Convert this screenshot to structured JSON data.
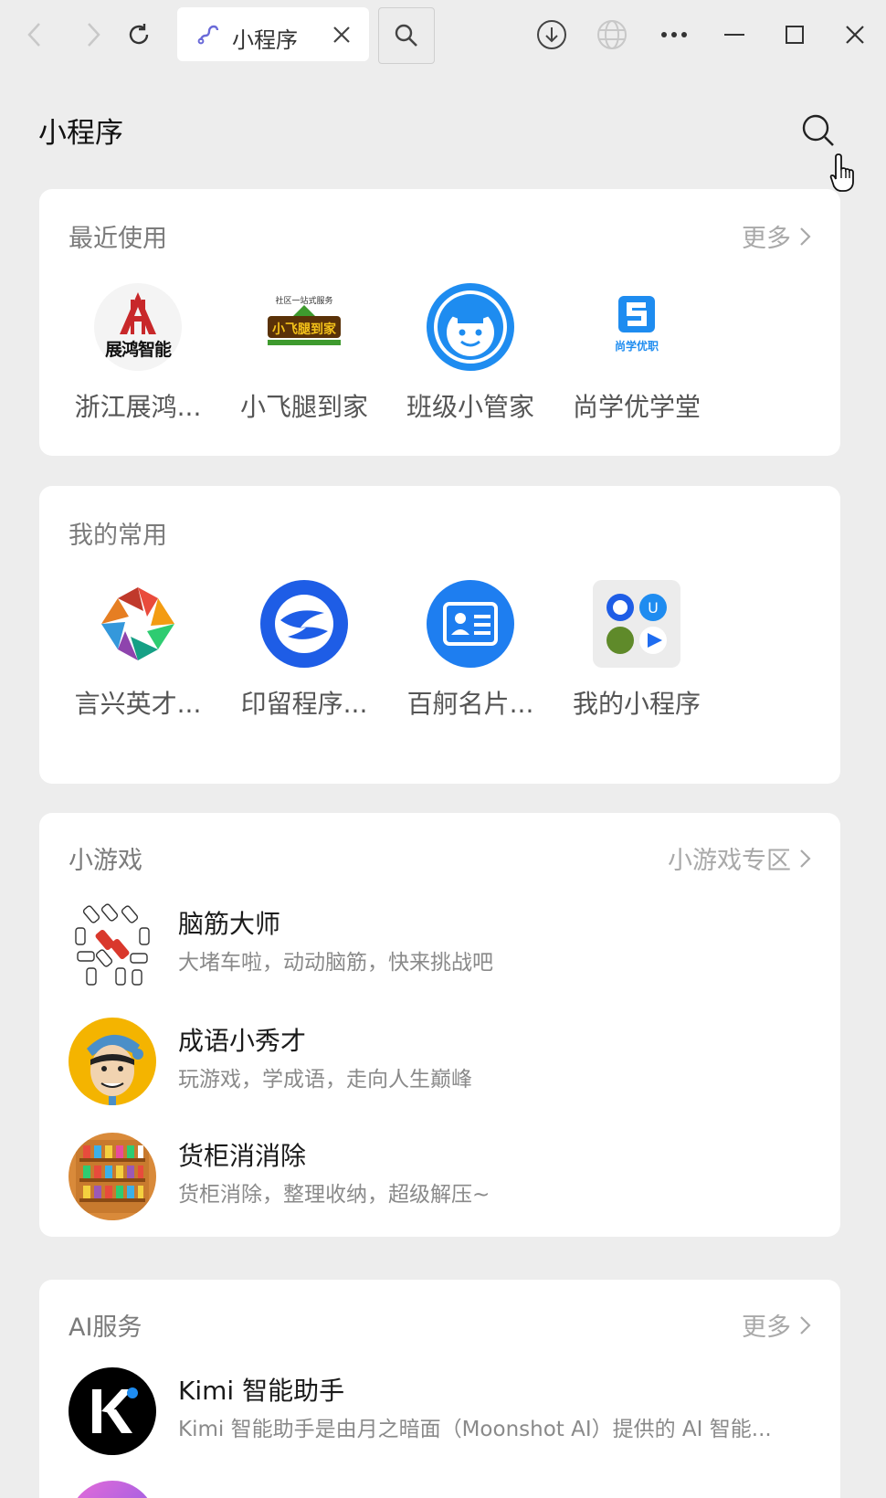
{
  "tab": {
    "title": "小程序"
  },
  "page": {
    "title": "小程序"
  },
  "recent": {
    "title": "最近使用",
    "more": "更多",
    "apps": [
      {
        "label": "浙江展鸿...",
        "icon": "zhanhong-logo"
      },
      {
        "label": "小飞腿到家",
        "icon": "xiaofeitui-logo"
      },
      {
        "label": "班级小管家",
        "icon": "banji-logo"
      },
      {
        "label": "尚学优学堂",
        "icon": "shangxue-logo"
      }
    ]
  },
  "frequent": {
    "title": "我的常用",
    "apps": [
      {
        "label": "言兴英才...",
        "icon": "yanxing-logo"
      },
      {
        "label": "印留程序...",
        "icon": "yinliu-logo"
      },
      {
        "label": "百舸名片...",
        "icon": "baige-card-logo"
      },
      {
        "label": "我的小程序",
        "icon": "my-miniprograms-grid"
      }
    ]
  },
  "games": {
    "title": "小游戏",
    "more": "小游戏专区",
    "items": [
      {
        "title": "脑筋大师",
        "desc": "大堵车啦，动动脑筋，快来挑战吧"
      },
      {
        "title": "成语小秀才",
        "desc": "玩游戏，学成语，走向人生巅峰"
      },
      {
        "title": "货柜消消除",
        "desc": "货柜消除，整理收纳，超级解压~"
      }
    ]
  },
  "ai": {
    "title": "AI服务",
    "more": "更多",
    "items": [
      {
        "title": "Kimi 智能助手",
        "desc": "Kimi 智能助手是由月之暗面（Moonshot AI）提供的 AI 智能..."
      }
    ]
  },
  "recent_logo_text": {
    "zhanhong": "展鸿智能",
    "xiaofeitui_top": "社区一站式服务",
    "xiaofeitui": "小飞腿到家",
    "shangxue": "尚学优职"
  },
  "colors": {
    "background": "#ededed",
    "card": "#ffffff",
    "accent_blue": "#1e8cf0",
    "muted": "#8a8a8a"
  }
}
